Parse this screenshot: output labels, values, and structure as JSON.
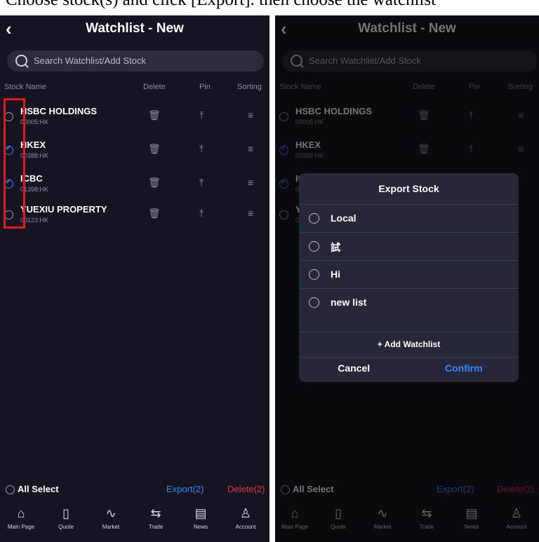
{
  "caption": "Choose stock(s) and click [Export]. then choose the watchlist",
  "header": {
    "back_icon": "‹",
    "title": "Watchlist - New"
  },
  "search": {
    "placeholder": "Search Watchlist/Add Stock"
  },
  "columns": {
    "name": "Stock Name",
    "delete": "Delete",
    "pin": "Pin",
    "sorting": "Sorting"
  },
  "stocks": [
    {
      "name": "HSBC HOLDINGS",
      "code": "00005:HK",
      "checked": false
    },
    {
      "name": "HKEX",
      "code": "00388:HK",
      "checked": true
    },
    {
      "name": "ICBC",
      "code": "01398:HK",
      "checked": true
    },
    {
      "name": "YUEXIU PROPERTY",
      "code": "00123:HK",
      "checked": false
    }
  ],
  "footer": {
    "all_select": "All Select",
    "export": "Export(2)",
    "delete": "Delete(2)"
  },
  "tabs": [
    {
      "label": "Main Page",
      "icon": "home-icon"
    },
    {
      "label": "Quote",
      "icon": "quote-icon"
    },
    {
      "label": "Market",
      "icon": "market-icon"
    },
    {
      "label": "Trade",
      "icon": "trade-icon"
    },
    {
      "label": "News",
      "icon": "news-icon"
    },
    {
      "label": "Account",
      "icon": "account-icon"
    }
  ],
  "modal": {
    "title": "Export Stock",
    "options": [
      "Local",
      "試",
      "Hi",
      "new list"
    ],
    "add_watchlist": "+ Add Watchlist",
    "cancel": "Cancel",
    "confirm": "Confirm"
  },
  "colors": {
    "accent": "#3a86ff",
    "danger": "#e8313b",
    "background": "#141521",
    "highlight": "#e8141e"
  }
}
